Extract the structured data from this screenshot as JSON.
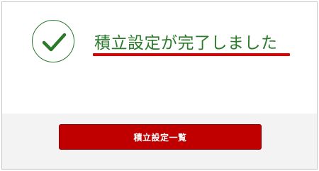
{
  "message": {
    "text": "積立設定が完了しました",
    "icon": "checkmark-circle-icon",
    "color": "#2a7a2a",
    "underline_color": "#e10000"
  },
  "actions": {
    "list_button_label": "積立設定一覧",
    "button_color": "#c00000"
  }
}
